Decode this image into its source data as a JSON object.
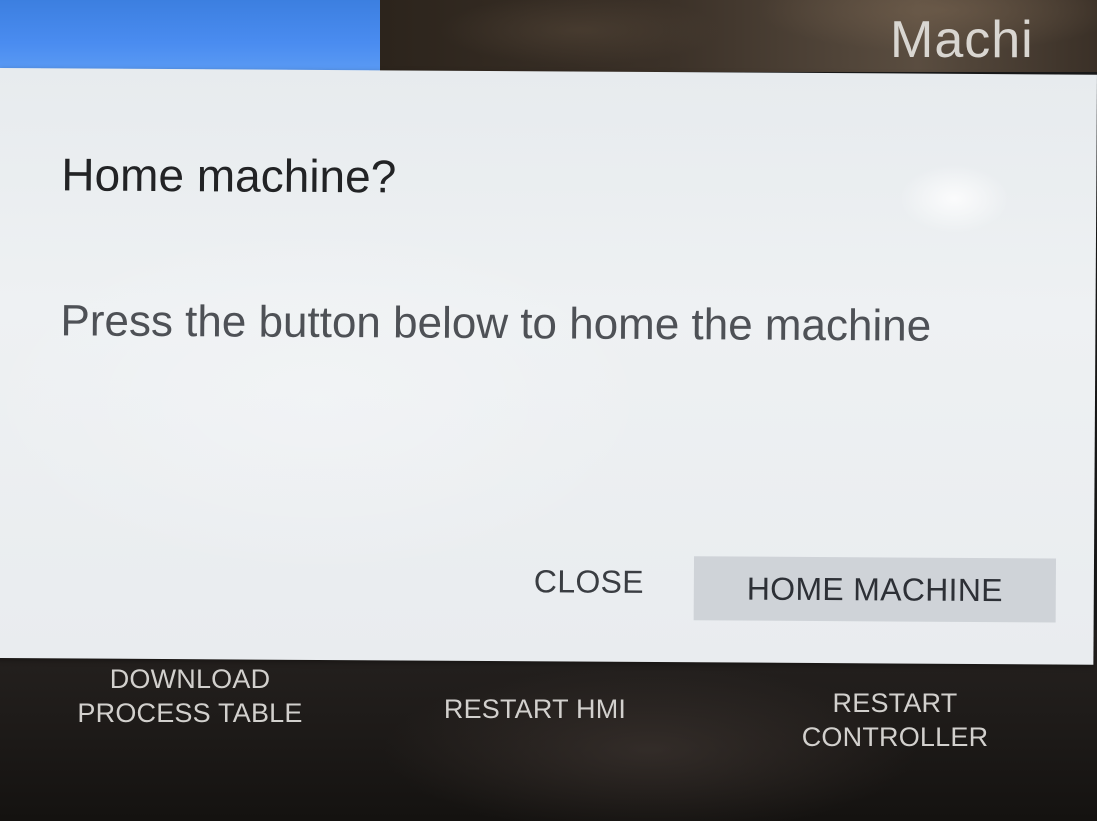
{
  "header": {
    "title": "Machi"
  },
  "dialog": {
    "title": "Home machine?",
    "message": "Press the button below to home the machine",
    "close_label": "CLOSE",
    "confirm_label": "HOME MACHINE"
  },
  "bottom_bar": {
    "download": {
      "line1": "DOWNLOAD",
      "line2": "PROCESS TABLE"
    },
    "restart_hmi": "RESTART HMI",
    "restart_controller": {
      "line1": "RESTART",
      "line2": "CONTROLLER"
    }
  },
  "colors": {
    "header_blue": "#4a8cf0",
    "dialog_bg": "#eef1f3",
    "primary_button_bg": "#cfd3d8",
    "bottom_bar_bg": "#1c1917"
  }
}
